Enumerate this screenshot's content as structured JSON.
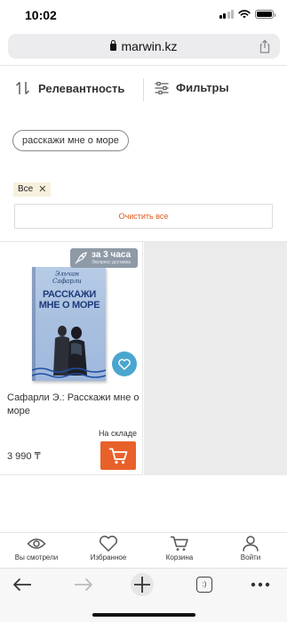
{
  "status_bar": {
    "time": "10:02"
  },
  "browser": {
    "url": "marwin.kz"
  },
  "sort": {
    "sort_label": "Релевантность",
    "filter_label": "Фильтры"
  },
  "search": {
    "query_chip": "расскажи мне о море"
  },
  "active_filters": {
    "all_label": "Все",
    "clear_all_label": "Очистить все"
  },
  "product": {
    "delivery_main": "за 3 часа",
    "delivery_sub": "Экспресс доставка",
    "book_author_cover": "Эльчин Сафарли",
    "book_title_cover": "РАССКАЖИ МНЕ О МОРЕ",
    "name": "Сафарли Э.: Расскажи мне о море",
    "stock": "На складе",
    "price": "3 990 ₸"
  },
  "bottom_nav": {
    "items": [
      {
        "label": "Вы смотрели",
        "icon": "eye-icon"
      },
      {
        "label": "Избранное",
        "icon": "heart-icon"
      },
      {
        "label": "Корзина",
        "icon": "cart-icon"
      },
      {
        "label": "Войти",
        "icon": "user-icon"
      }
    ]
  },
  "browser_toolbar": {
    "tabs_count": ":)"
  },
  "colors": {
    "accent_orange": "#e8612b",
    "fav_blue": "#4aa6cf",
    "badge_gray": "#8f9aa7"
  }
}
